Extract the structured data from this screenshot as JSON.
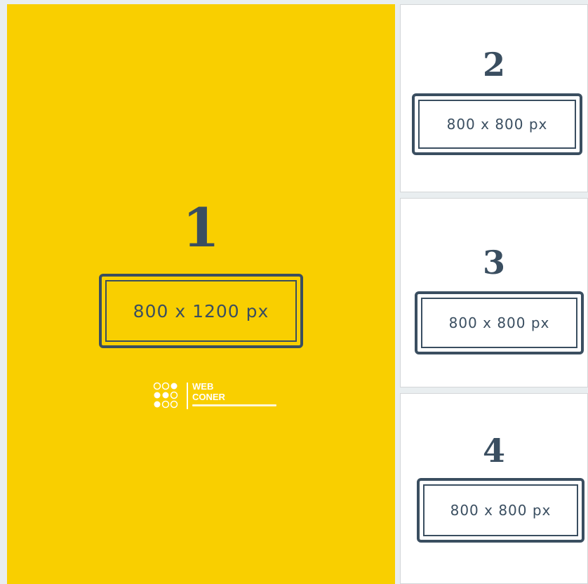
{
  "panels": [
    {
      "number": "1",
      "size_label": "800 x 1200 px"
    },
    {
      "number": "2",
      "size_label": "800 x 800 px"
    },
    {
      "number": "3",
      "size_label": "800 x 800 px"
    },
    {
      "number": "4",
      "size_label": "800 x 800 px"
    }
  ],
  "logo": {
    "line1": "WEB",
    "line2": "CONER",
    "icon": "dot-grid-logo"
  },
  "colors": {
    "yellow": "#f9cf00",
    "navy": "#3a4e60",
    "white": "#ffffff",
    "background": "#e9eef0"
  }
}
